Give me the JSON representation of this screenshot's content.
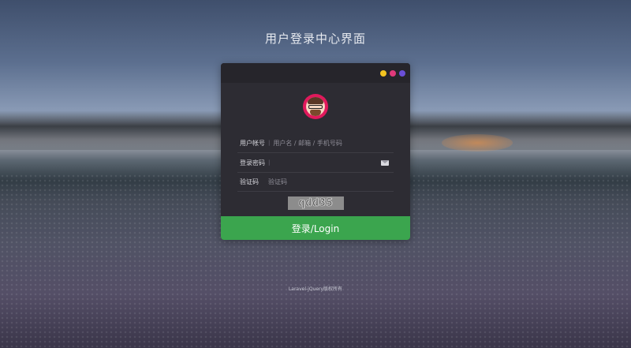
{
  "page": {
    "title": "用户登录中心界面",
    "footer": "Laravel-jQuery版权所有"
  },
  "window_dots": {
    "yellow": "#f2c320",
    "pink": "#e0397a",
    "purple": "#6a4fd8"
  },
  "form": {
    "username": {
      "label": "用户帐号",
      "separator": "|",
      "placeholder": "用户名 / 邮箱 / 手机号码",
      "value": ""
    },
    "password": {
      "label": "登录密码",
      "separator": "|",
      "placeholder": "",
      "value": ""
    },
    "captcha_field": {
      "label": "验证码",
      "placeholder": "验证码",
      "value": ""
    },
    "captcha_image_text": "qdd35",
    "submit_label": "登录/Login"
  },
  "colors": {
    "panel_bg": "#2d2c33",
    "submit_bg": "#3ba54e",
    "avatar_ring": "#e0195c"
  },
  "icons": {
    "avatar": "avatar-icon",
    "password_hint": "mail-icon"
  }
}
